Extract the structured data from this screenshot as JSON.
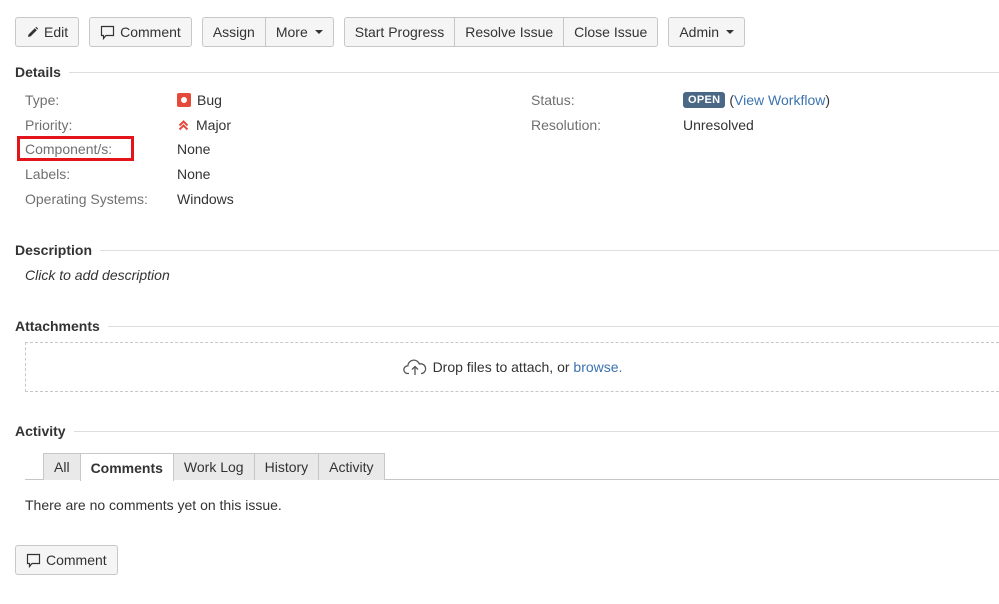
{
  "toolbar": {
    "edit": "Edit",
    "comment": "Comment",
    "assign": "Assign",
    "more": "More",
    "start_progress": "Start Progress",
    "resolve_issue": "Resolve Issue",
    "close_issue": "Close Issue",
    "admin": "Admin"
  },
  "details": {
    "heading": "Details",
    "type_label": "Type:",
    "type_value": "Bug",
    "priority_label": "Priority:",
    "priority_value": "Major",
    "components_label": "Component/s:",
    "components_value": "None",
    "labels_label": "Labels:",
    "labels_value": "None",
    "os_label": "Operating Systems:",
    "os_value": "Windows",
    "status_label": "Status:",
    "status_value": "OPEN",
    "workflow_open_paren": "(",
    "workflow_link": "View Workflow",
    "workflow_close_paren": ")",
    "resolution_label": "Resolution:",
    "resolution_value": "Unresolved"
  },
  "description": {
    "heading": "Description",
    "placeholder": "Click to add description"
  },
  "attachments": {
    "heading": "Attachments",
    "drop_text": "Drop files to attach, or",
    "browse_link": "browse."
  },
  "activity": {
    "heading": "Activity",
    "tabs": [
      "All",
      "Comments",
      "Work Log",
      "History",
      "Activity"
    ],
    "active_tab": "Comments",
    "empty_text": "There are no comments yet on this issue.",
    "comment_button": "Comment"
  },
  "colors": {
    "bug": "#e5493a",
    "priority_major": "#e5493a",
    "status_lozenge": "#4a6785",
    "link": "#3b73af",
    "highlight": "#e3151a"
  }
}
